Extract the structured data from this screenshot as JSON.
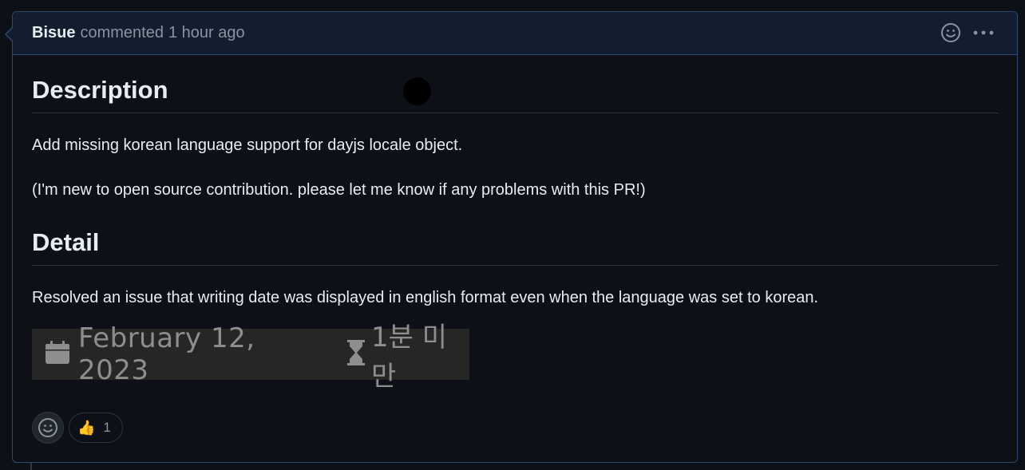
{
  "comment": {
    "author": "Bisue",
    "action": "commented",
    "time": "1 hour ago",
    "header_icons": [
      "smiley-icon",
      "kebab-menu-icon"
    ]
  },
  "body": {
    "heading_description": "Description",
    "para_1": "Add missing korean language support for dayjs locale object.",
    "para_2": "(I'm new to open source contribution. please let me know if any problems with this PR!)",
    "heading_detail": "Detail",
    "para_3": "Resolved an issue that writing date was displayed in english format even when the language was set to korean.",
    "image": {
      "date": "February 12, 2023",
      "reading_time": "1분 미만",
      "icons": [
        "calendar-icon",
        "hourglass-icon"
      ]
    }
  },
  "reactions": {
    "thumbs_up_emoji": "👍",
    "thumbs_up_count": "1"
  },
  "colors": {
    "background": "#0d1117",
    "header_bg": "#121d2f",
    "border_accent": "#30486b",
    "text": "#e6edf3",
    "muted": "#8b949e"
  }
}
